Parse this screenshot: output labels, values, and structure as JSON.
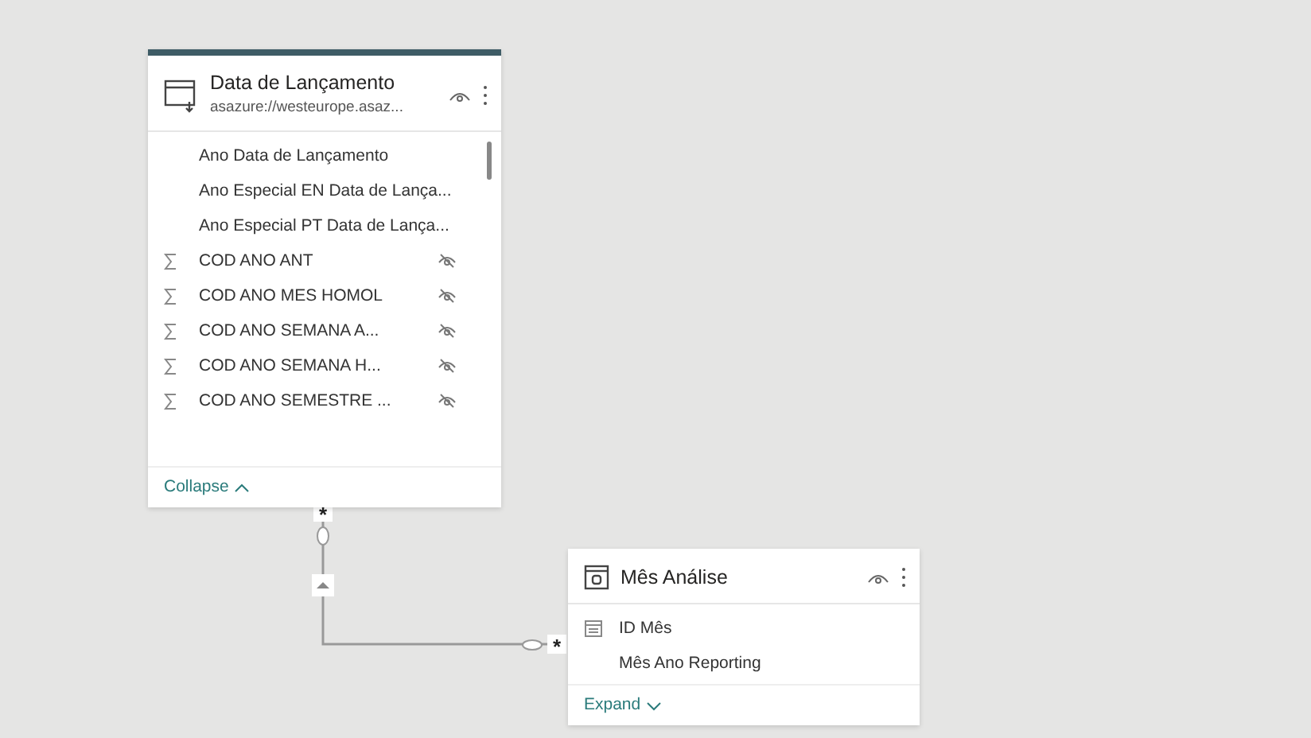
{
  "tables": [
    {
      "title": "Data de Lançamento",
      "subtitle": "asazure://westeurope.asaz...",
      "selected": true,
      "fields": [
        {
          "name": "Ano Data de Lançamento",
          "kind": "column",
          "hidden": false
        },
        {
          "name": "Ano Especial EN Data de Lança...",
          "kind": "column",
          "hidden": false
        },
        {
          "name": "Ano Especial PT Data de Lança...",
          "kind": "column",
          "hidden": false
        },
        {
          "name": "COD ANO ANT",
          "kind": "sum",
          "hidden": true
        },
        {
          "name": "COD ANO MES HOMOL",
          "kind": "sum",
          "hidden": true
        },
        {
          "name": "COD ANO SEMANA A...",
          "kind": "sum",
          "hidden": true
        },
        {
          "name": "COD ANO SEMANA H...",
          "kind": "sum",
          "hidden": true
        },
        {
          "name": "COD ANO SEMESTRE ...",
          "kind": "sum",
          "hidden": true
        }
      ],
      "toggle": "Collapse",
      "expanded": true
    },
    {
      "title": "Mês Análise",
      "selected": false,
      "fields": [
        {
          "name": "ID Mês",
          "kind": "date",
          "hidden": false
        },
        {
          "name": "Mês Ano Reporting",
          "kind": "column",
          "hidden": false
        }
      ],
      "toggle": "Expand",
      "expanded": false
    }
  ],
  "relationship": {
    "from_cardinality": "*",
    "to_cardinality": "*"
  }
}
